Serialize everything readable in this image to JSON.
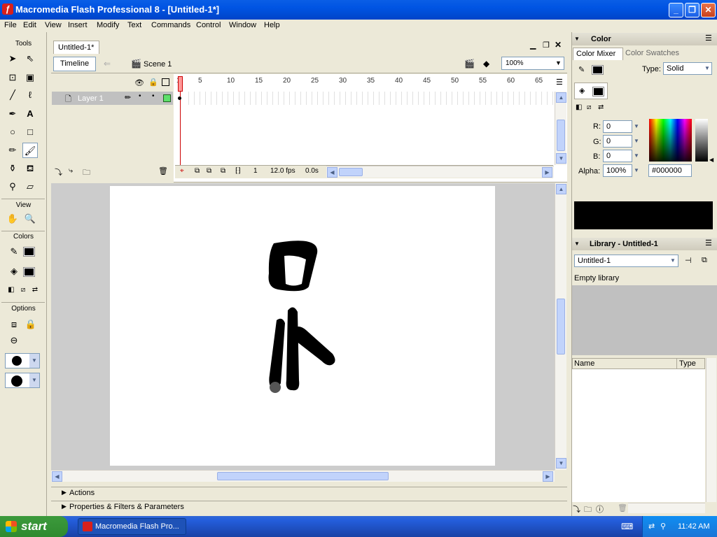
{
  "window": {
    "title": "Macromedia Flash Professional 8 - [Untitled-1*]"
  },
  "menu": [
    "File",
    "Edit",
    "View",
    "Insert",
    "Modify",
    "Text",
    "Commands",
    "Control",
    "Window",
    "Help"
  ],
  "tools": {
    "title": "Tools",
    "view_label": "View",
    "colors_label": "Colors",
    "options_label": "Options"
  },
  "document": {
    "tab": "Untitled-1*",
    "timeline_button": "Timeline",
    "scene": "Scene 1",
    "zoom": "100%"
  },
  "timeline": {
    "layer_name": "Layer 1",
    "frame_numbers": [
      "1",
      "5",
      "10",
      "15",
      "20",
      "25",
      "30",
      "35",
      "40",
      "45",
      "50",
      "55",
      "60",
      "65"
    ],
    "current_frame": "1",
    "fps": "12.0 fps",
    "elapsed": "0.0s"
  },
  "panels": {
    "actions": "Actions",
    "properties": "Properties & Filters & Parameters"
  },
  "color_panel": {
    "title": "Color",
    "tab_mixer": "Color Mixer",
    "tab_swatches": "Color Swatches",
    "type_label": "Type:",
    "type_value": "Solid",
    "r_label": "R:",
    "r_value": "0",
    "g_label": "G:",
    "g_value": "0",
    "b_label": "B:",
    "b_value": "0",
    "alpha_label": "Alpha:",
    "alpha_value": "100%",
    "hex": "#000000",
    "color": "#000000"
  },
  "library_panel": {
    "title": "Library - Untitled-1",
    "doc_select": "Untitled-1",
    "status": "Empty library",
    "col_name": "Name",
    "col_type": "Type"
  },
  "taskbar": {
    "start": "start",
    "task": "Macromedia Flash Pro...",
    "clock": "11:42 AM"
  }
}
